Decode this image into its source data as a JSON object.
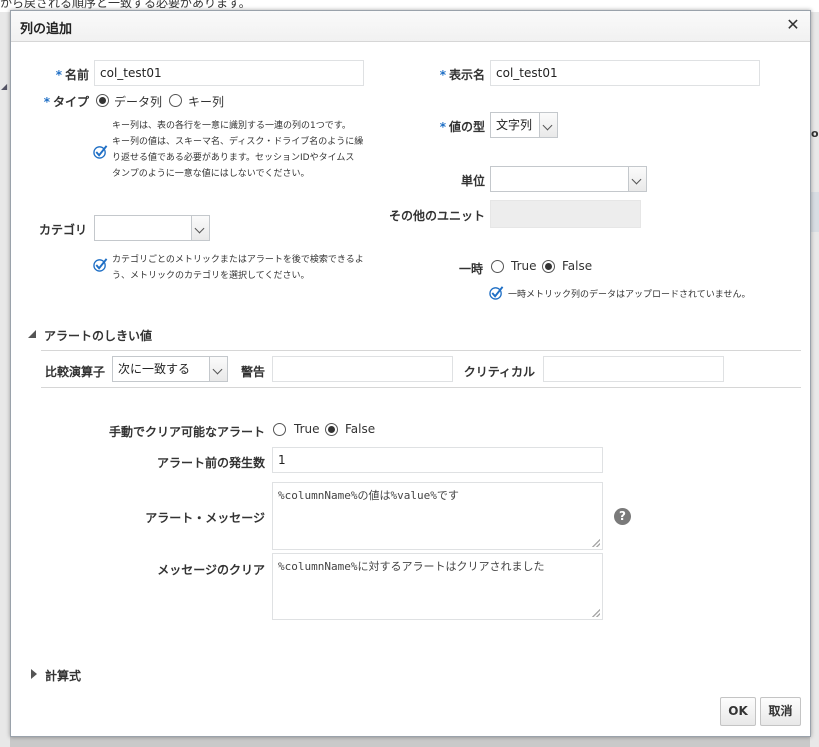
{
  "background": {
    "top_text": "から戻される順序と一致する必要があります。",
    "right_text": "ol"
  },
  "dialog": {
    "title": "列の追加"
  },
  "form": {
    "name": {
      "label": "名前",
      "value": "col_test01"
    },
    "display_name": {
      "label": "表示名",
      "value": "col_test01"
    },
    "type": {
      "label": "タイプ",
      "options": [
        "データ列",
        "キー列"
      ],
      "selected": "データ列",
      "info": [
        "キー列は、表の各行を一意に識別する一連の列の1つです。",
        "キー列の値は、スキーマ名、ディスク・ドライブ名のように繰",
        "り返せる値である必要があります。セッションIDやタイムス",
        "タンプのように一意な値にはしないでください。"
      ]
    },
    "value_type": {
      "label": "値の型",
      "value": "文字列"
    },
    "unit": {
      "label": "単位",
      "value": ""
    },
    "other_unit": {
      "label": "その他のユニット",
      "value": ""
    },
    "category": {
      "label": "カテゴリ",
      "value": "",
      "info": [
        "カテゴリごとのメトリックまたはアラートを後で検索できるよ",
        "う、メトリックのカテゴリを選択してください。"
      ]
    },
    "temporary": {
      "label": "一時",
      "options": [
        "True",
        "False"
      ],
      "selected": "False",
      "info": "一時メトリック列のデータはアップロードされていません。"
    }
  },
  "alert_section": {
    "title": "アラートのしきい値",
    "operator": {
      "label": "比較演算子",
      "value": "次に一致する"
    },
    "warning": {
      "label": "警告",
      "value": ""
    },
    "critical": {
      "label": "クリティカル",
      "value": ""
    },
    "manual_clear": {
      "label": "手動でクリア可能なアラート",
      "options": [
        "True",
        "False"
      ],
      "selected": "False"
    },
    "occurrences": {
      "label": "アラート前の発生数",
      "value": "1"
    },
    "alert_message": {
      "label": "アラート・メッセージ",
      "value": "%columnName%の値は%value%です"
    },
    "clear_message": {
      "label": "メッセージのクリア",
      "value": "%columnName%に対するアラートはクリアされました"
    }
  },
  "formula_section": {
    "title": "計算式"
  },
  "buttons": {
    "ok": "OK",
    "cancel": "取消"
  },
  "colors": {
    "accent": "#1f6fc5",
    "check": "#1f6fc5"
  }
}
